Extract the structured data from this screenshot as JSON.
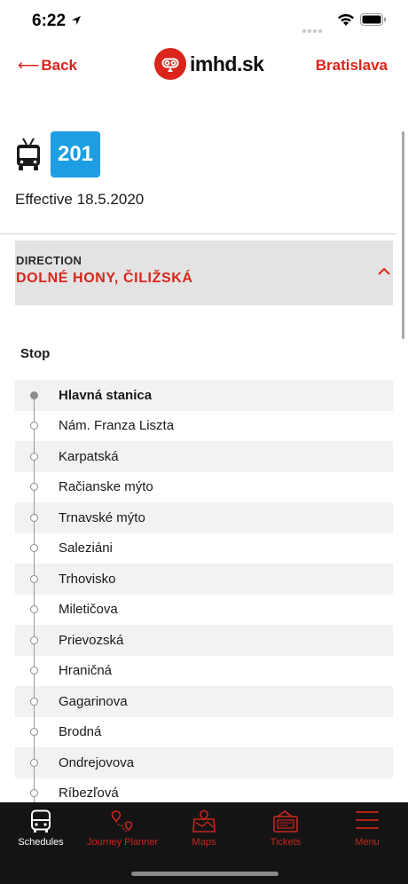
{
  "status_bar": {
    "time": "6:22"
  },
  "nav": {
    "back_label": "Back",
    "logo_text": "imhd.sk",
    "city_label": "Bratislava"
  },
  "line": {
    "vehicle_icon": "trolleybus-icon",
    "number": "201",
    "badge_color": "#1d9ee2",
    "effective": "Effective 18.5.2020"
  },
  "direction": {
    "label": "DIRECTION",
    "value": "DOLNÉ HONY, ČILIŽSKÁ"
  },
  "stops_header": "Stop",
  "stops": [
    "Hlavná stanica",
    "Nám. Franza Liszta",
    "Karpatská",
    "Račianske mýto",
    "Trnavské mýto",
    "Saleziáni",
    "Trhovisko",
    "Miletičova",
    "Prievozská",
    "Hraničná",
    "Gagarinova",
    "Brodná",
    "Ondrejovova",
    "Ríbezľová"
  ],
  "tabs": [
    {
      "label": "Schedules",
      "icon": "bus-icon",
      "active": true
    },
    {
      "label": "Journey Planner",
      "icon": "route-pin-icon",
      "active": false
    },
    {
      "label": "Maps",
      "icon": "map-icon",
      "active": false
    },
    {
      "label": "Tickets",
      "icon": "ticket-icon",
      "active": false
    },
    {
      "label": "Menu",
      "icon": "menu-icon",
      "active": false
    }
  ],
  "colors": {
    "accent": "#d9251c",
    "tab_bar": "#141414",
    "direction_bg": "#e3e3e3"
  }
}
